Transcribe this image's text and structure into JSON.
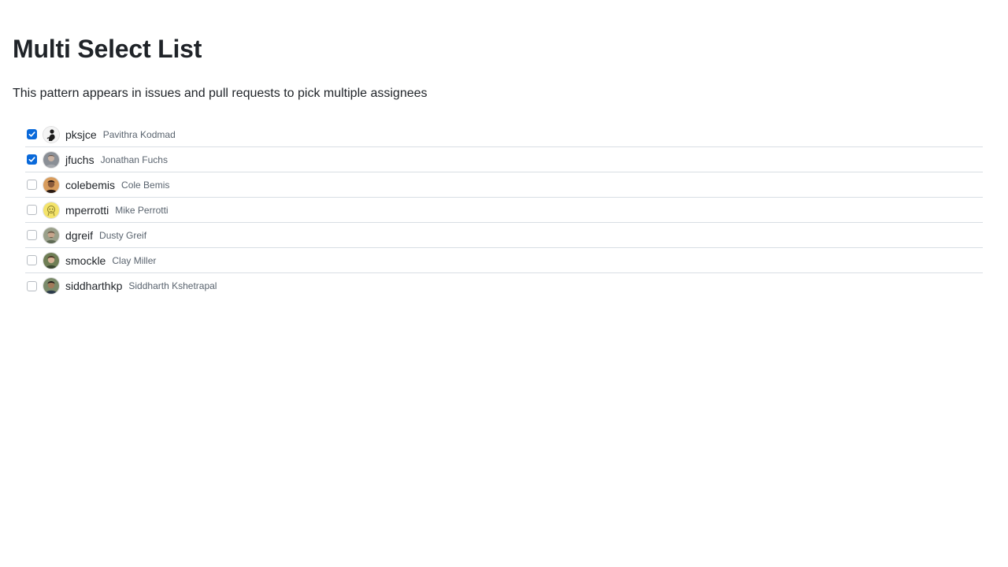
{
  "page": {
    "title": "Multi Select List",
    "description": "This pattern appears in issues and pull requests to pick multiple assignees"
  },
  "users": [
    {
      "login": "pksjce",
      "name": "Pavithra Kodmad",
      "checked": true,
      "avatar": "pksjce-avatar"
    },
    {
      "login": "jfuchs",
      "name": "Jonathan Fuchs",
      "checked": true,
      "avatar": "jfuchs-avatar"
    },
    {
      "login": "colebemis",
      "name": "Cole Bemis",
      "checked": false,
      "avatar": "colebemis-avatar"
    },
    {
      "login": "mperrotti",
      "name": "Mike Perrotti",
      "checked": false,
      "avatar": "mperrotti-avatar"
    },
    {
      "login": "dgreif",
      "name": "Dusty Greif",
      "checked": false,
      "avatar": "dgreif-avatar"
    },
    {
      "login": "smockle",
      "name": "Clay Miller",
      "checked": false,
      "avatar": "smockle-avatar"
    },
    {
      "login": "siddharthkp",
      "name": "Siddharth Kshetrapal",
      "checked": false,
      "avatar": "siddharthkp-avatar"
    }
  ],
  "colors": {
    "accent": "#0969da",
    "text": "#1f2328",
    "muted": "#59636e",
    "divider": "#d8dee4"
  }
}
